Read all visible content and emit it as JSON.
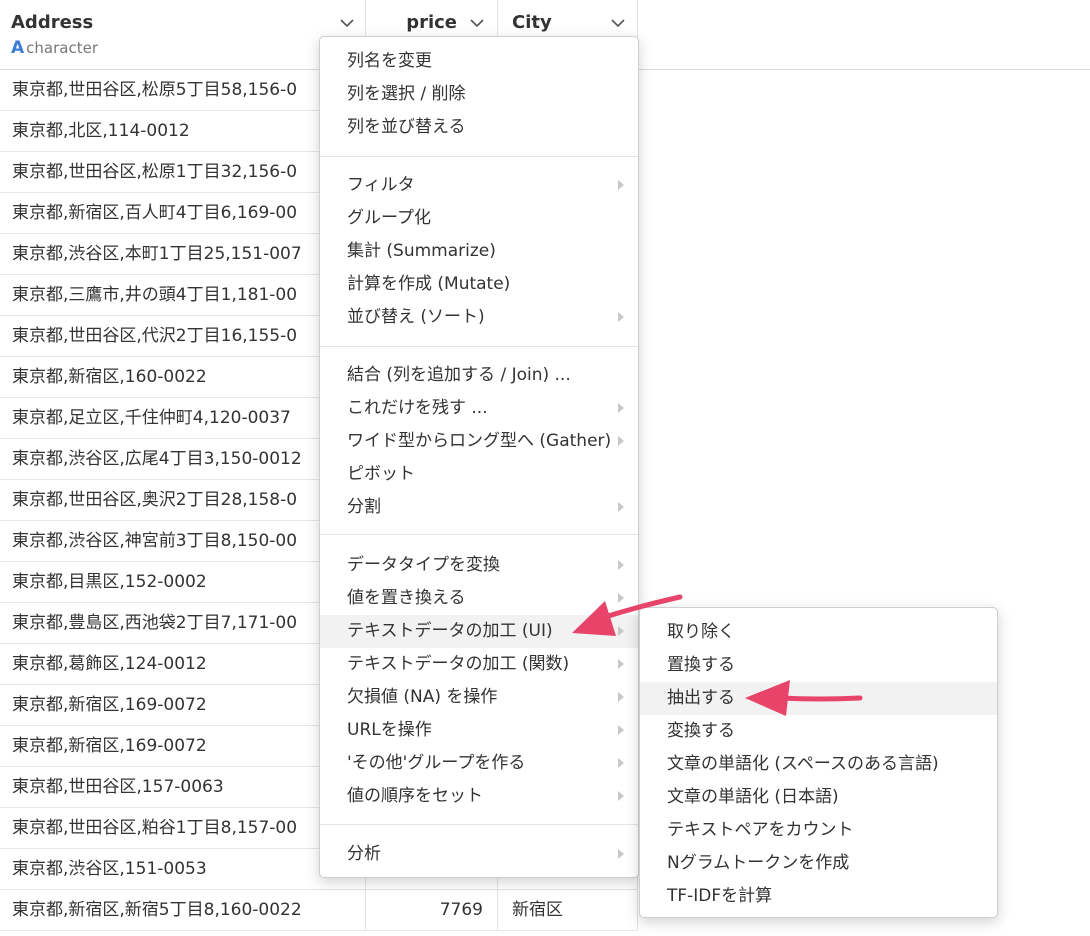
{
  "columns": [
    {
      "name": "Address",
      "type_label": "character",
      "type_icon": "A"
    },
    {
      "name": "price"
    },
    {
      "name": "City"
    }
  ],
  "rows": [
    {
      "address": "東京都,世田谷区,松原5丁目58,156-0",
      "price": "",
      "city": ""
    },
    {
      "address": "東京都,北区,114-0012",
      "price": "",
      "city": ""
    },
    {
      "address": "東京都,世田谷区,松原1丁目32,156-0",
      "price": "",
      "city": ""
    },
    {
      "address": "東京都,新宿区,百人町4丁目6,169-00",
      "price": "",
      "city": ""
    },
    {
      "address": "東京都,渋谷区,本町1丁目25,151-007",
      "price": "",
      "city": ""
    },
    {
      "address": "東京都,三鷹市,井の頭4丁目1,181-00",
      "price": "",
      "city": ""
    },
    {
      "address": "東京都,世田谷区,代沢2丁目16,155-0",
      "price": "",
      "city": ""
    },
    {
      "address": "東京都,新宿区,160-0022",
      "price": "",
      "city": ""
    },
    {
      "address": "東京都,足立区,千住仲町4,120-0037",
      "price": "",
      "city": ""
    },
    {
      "address": "東京都,渋谷区,広尾4丁目3,150-0012",
      "price": "",
      "city": ""
    },
    {
      "address": "東京都,世田谷区,奥沢2丁目28,158-0",
      "price": "",
      "city": ""
    },
    {
      "address": "東京都,渋谷区,神宮前3丁目8,150-00",
      "price": "",
      "city": ""
    },
    {
      "address": "東京都,目黒区,152-0002",
      "price": "",
      "city": ""
    },
    {
      "address": "東京都,豊島区,西池袋2丁目7,171-00",
      "price": "",
      "city": ""
    },
    {
      "address": "東京都,葛飾区,124-0012",
      "price": "",
      "city": ""
    },
    {
      "address": "東京都,新宿区,169-0072",
      "price": "",
      "city": ""
    },
    {
      "address": "東京都,新宿区,169-0072",
      "price": "",
      "city": ""
    },
    {
      "address": "東京都,世田谷区,157-0063",
      "price": "",
      "city": ""
    },
    {
      "address": "東京都,世田谷区,粕谷1丁目8,157-00",
      "price": "",
      "city": ""
    },
    {
      "address": "東京都,渋谷区,151-0053",
      "price": "",
      "city": ""
    },
    {
      "address": "東京都,新宿区,新宿5丁目8,160-0022",
      "price": "7769",
      "city": "新宿区"
    }
  ],
  "context_menu": {
    "items": [
      {
        "label": "列名を変更",
        "submenu": false
      },
      {
        "label": "列を選択 / 削除",
        "submenu": false
      },
      {
        "label": "列を並び替える",
        "submenu": false
      },
      {
        "label": "フィルタ",
        "submenu": true
      },
      {
        "label": "グループ化",
        "submenu": false
      },
      {
        "label": "集計 (Summarize)",
        "submenu": false
      },
      {
        "label": "計算を作成 (Mutate)",
        "submenu": false
      },
      {
        "label": "並び替え (ソート)",
        "submenu": true
      },
      {
        "label": "結合 (列を追加する / Join) ...",
        "submenu": false
      },
      {
        "label": "これだけを残す ...",
        "submenu": true
      },
      {
        "label": "ワイド型からロング型へ (Gather)",
        "submenu": true
      },
      {
        "label": "ピボット",
        "submenu": false
      },
      {
        "label": "分割",
        "submenu": true
      },
      {
        "label": "データタイプを変換",
        "submenu": true
      },
      {
        "label": "値を置き換える",
        "submenu": true
      },
      {
        "label": "テキストデータの加工 (UI)",
        "submenu": true,
        "highlighted": true
      },
      {
        "label": "テキストデータの加工 (関数)",
        "submenu": true
      },
      {
        "label": "欠損値 (NA) を操作",
        "submenu": true
      },
      {
        "label": "URLを操作",
        "submenu": true
      },
      {
        "label": "'その他'グループを作る",
        "submenu": true
      },
      {
        "label": "値の順序をセット",
        "submenu": true
      },
      {
        "label": "分析",
        "submenu": true
      }
    ]
  },
  "submenu": {
    "items": [
      {
        "label": "取り除く"
      },
      {
        "label": "置換する"
      },
      {
        "label": "抽出する",
        "highlighted": true
      },
      {
        "label": "変換する"
      },
      {
        "label": "文章の単語化 (スペースのある言語)"
      },
      {
        "label": "文章の単語化 (日本語)"
      },
      {
        "label": "テキストペアをカウント"
      },
      {
        "label": "Nグラムトークンを作成"
      },
      {
        "label": "TF-IDFを計算"
      }
    ]
  },
  "colors": {
    "arrow": "#e8446a",
    "type_icon": "#3a7bd5",
    "highlight": "#f2f2f2"
  }
}
